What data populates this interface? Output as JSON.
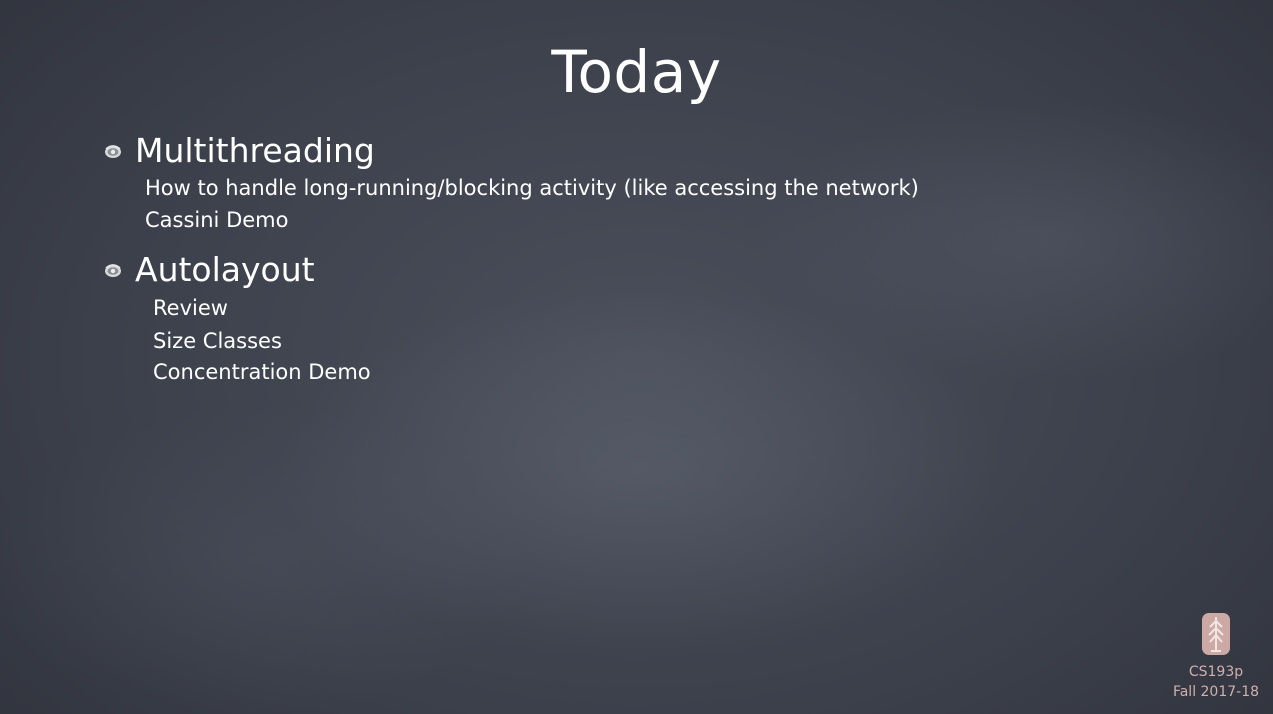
{
  "slide": {
    "title": "Today",
    "bullets": [
      {
        "icon": "bullet-eye-icon",
        "label": "Multithreading",
        "subitems": [
          "How to handle long-running/blocking activity (like accessing the network)",
          "Cassini Demo"
        ]
      },
      {
        "icon": "bullet-eye-icon",
        "label": "Autolayout",
        "subitems": [
          "Review",
          "Size Classes",
          "Concentration Demo"
        ]
      }
    ]
  },
  "footer": {
    "logo": "stanford-tree-logo",
    "course": "CS193p",
    "term": "Fall  2017-18"
  },
  "colors": {
    "background": "#3c404b",
    "text": "#ffffff",
    "footer_text": "#cfb0ad"
  }
}
